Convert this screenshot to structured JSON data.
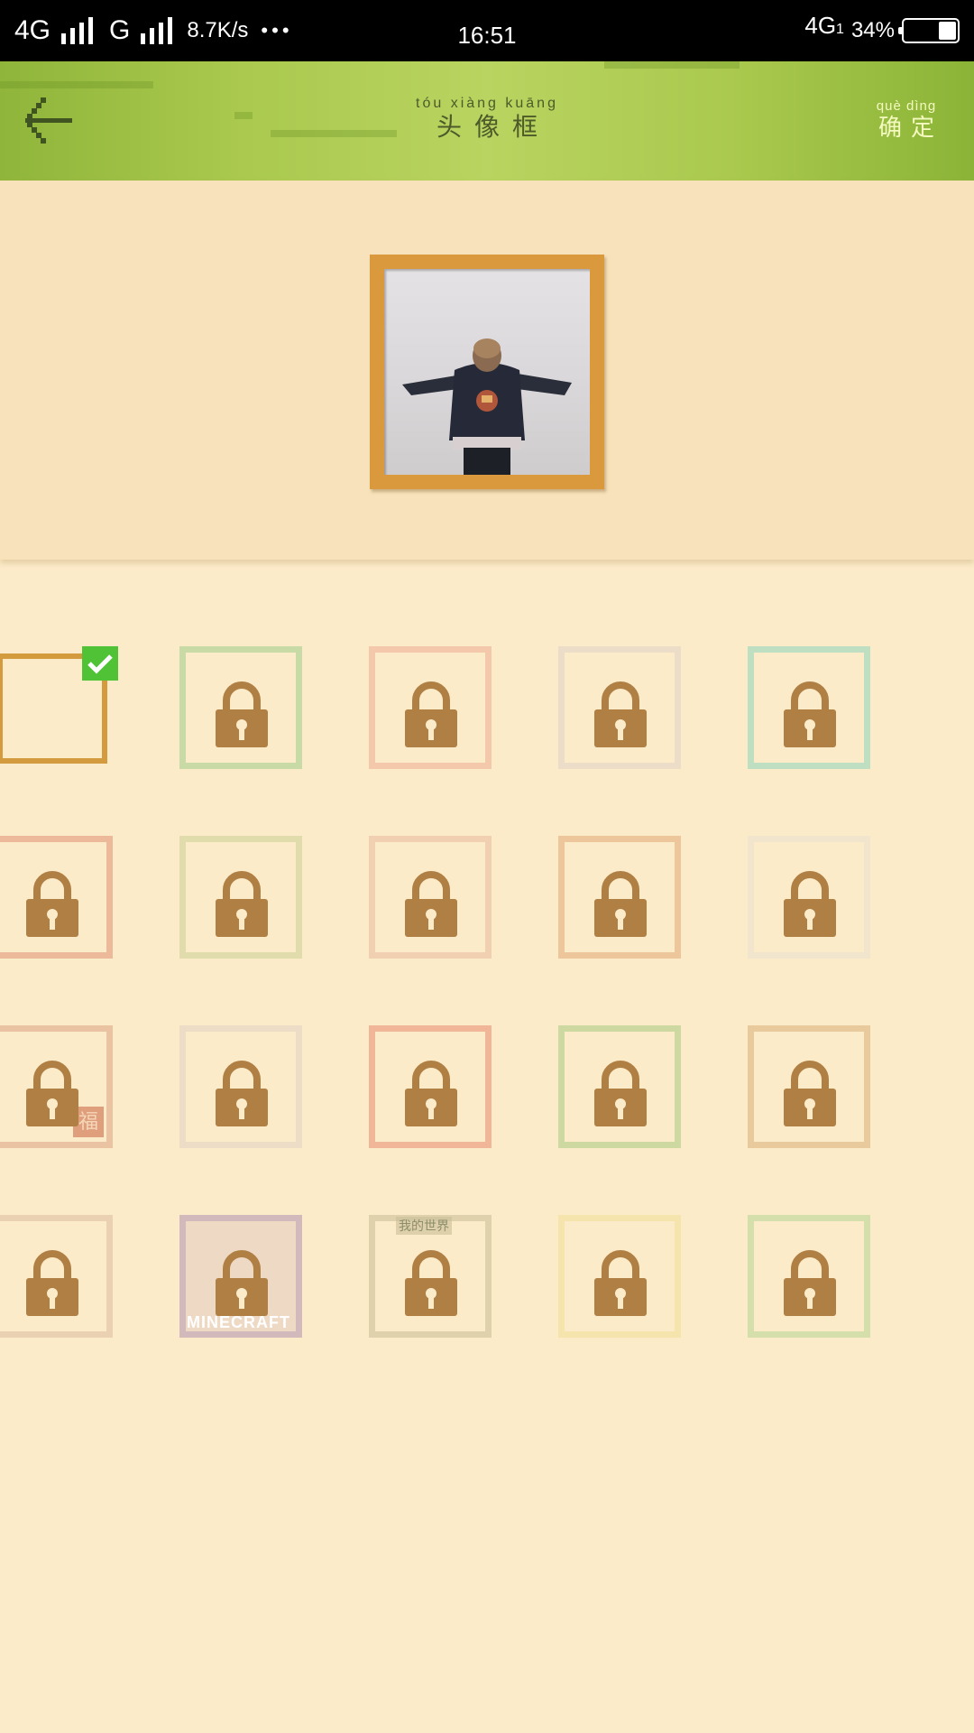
{
  "status_bar": {
    "network1": "4G",
    "network2": "G",
    "speed": "8.7K/s",
    "dots": "•••",
    "time": "16:51",
    "network_right": "4G",
    "network_right_sub": "1",
    "battery": "34%",
    "battery_level": 0.34
  },
  "header": {
    "title_pinyin": "tóu xiàng kuāng",
    "title": "头像框",
    "confirm_pinyin": "què dìng",
    "confirm": "确定",
    "back_icon": "back-arrow-icon"
  },
  "frames": [
    {
      "id": "f1",
      "color": "#d39a3e",
      "locked": false,
      "selected": true
    },
    {
      "id": "f2",
      "color": "#b7d69a",
      "locked": true
    },
    {
      "id": "f3",
      "color": "#f2bca0",
      "locked": true
    },
    {
      "id": "f4",
      "color": "#e6d8c6",
      "locked": true
    },
    {
      "id": "f5",
      "color": "#a9dbbf",
      "locked": true
    },
    {
      "id": "f6",
      "color": "#e7a98a",
      "locked": true
    },
    {
      "id": "f7",
      "color": "#d7d7a0",
      "locked": true
    },
    {
      "id": "f8",
      "color": "#eec6a8",
      "locked": true
    },
    {
      "id": "f9",
      "color": "#e9b98c",
      "locked": true
    },
    {
      "id": "f10",
      "color": "#efe3cf",
      "locked": true
    },
    {
      "id": "f11",
      "color": "#e3b594",
      "locked": true,
      "badge": "福"
    },
    {
      "id": "f12",
      "color": "#e9d8c4",
      "locked": true
    },
    {
      "id": "f13",
      "color": "#eca486",
      "locked": true
    },
    {
      "id": "f14",
      "color": "#bfd393",
      "locked": true
    },
    {
      "id": "f15",
      "color": "#e3bf8c",
      "locked": true
    },
    {
      "id": "f16",
      "color": "#e3c8a8",
      "locked": true
    },
    {
      "id": "f17",
      "color": "#c3a9b8",
      "locked": true,
      "label": "MINECRAFT"
    },
    {
      "id": "f18",
      "color": "#d6c8a2",
      "locked": true,
      "label_top": "我的世界"
    },
    {
      "id": "f19",
      "color": "#f3e2a2",
      "locked": true
    },
    {
      "id": "f20",
      "color": "#c8dba2",
      "locked": true
    }
  ],
  "colors": {
    "header_green": "#aac94e",
    "background": "#fcebc9",
    "lock": "#b07f44",
    "check_green": "#4fc236"
  }
}
